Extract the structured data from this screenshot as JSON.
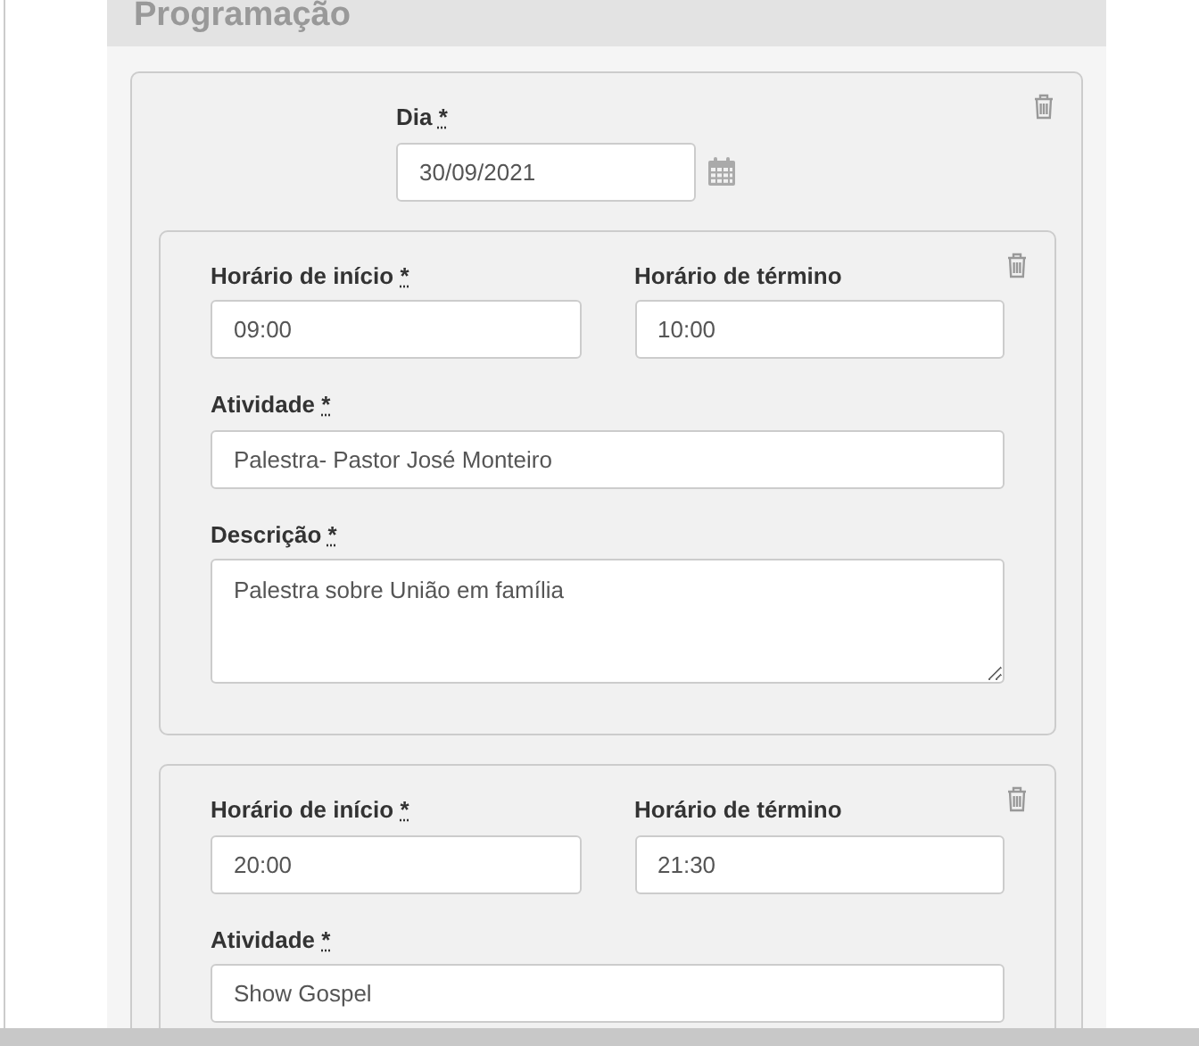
{
  "section": {
    "title": "Programação"
  },
  "days": [
    {
      "label": "Dia",
      "mark": "*",
      "date": "30/09/2021",
      "activities": [
        {
          "fields": [
            {
              "kind": "time",
              "label": "Horário de início",
              "mark": "*",
              "value": "09:00"
            },
            {
              "kind": "time",
              "label": "Horário de término",
              "value": "10:00"
            },
            {
              "kind": "text",
              "label": "Atividade",
              "mark": "*",
              "value": "Palestra- Pastor José Monteiro"
            },
            {
              "kind": "textarea",
              "label": "Descrição",
              "mark": "*",
              "value": "Palestra sobre União em família"
            }
          ]
        },
        {
          "fields": [
            {
              "kind": "time",
              "label": "Horário de início",
              "mark": "*",
              "value": "20:00"
            },
            {
              "kind": "time",
              "label": "Horário de término",
              "value": "21:30"
            },
            {
              "kind": "text",
              "label": "Atividade",
              "mark": "*",
              "value": "Show Gospel"
            }
          ]
        }
      ]
    }
  ]
}
